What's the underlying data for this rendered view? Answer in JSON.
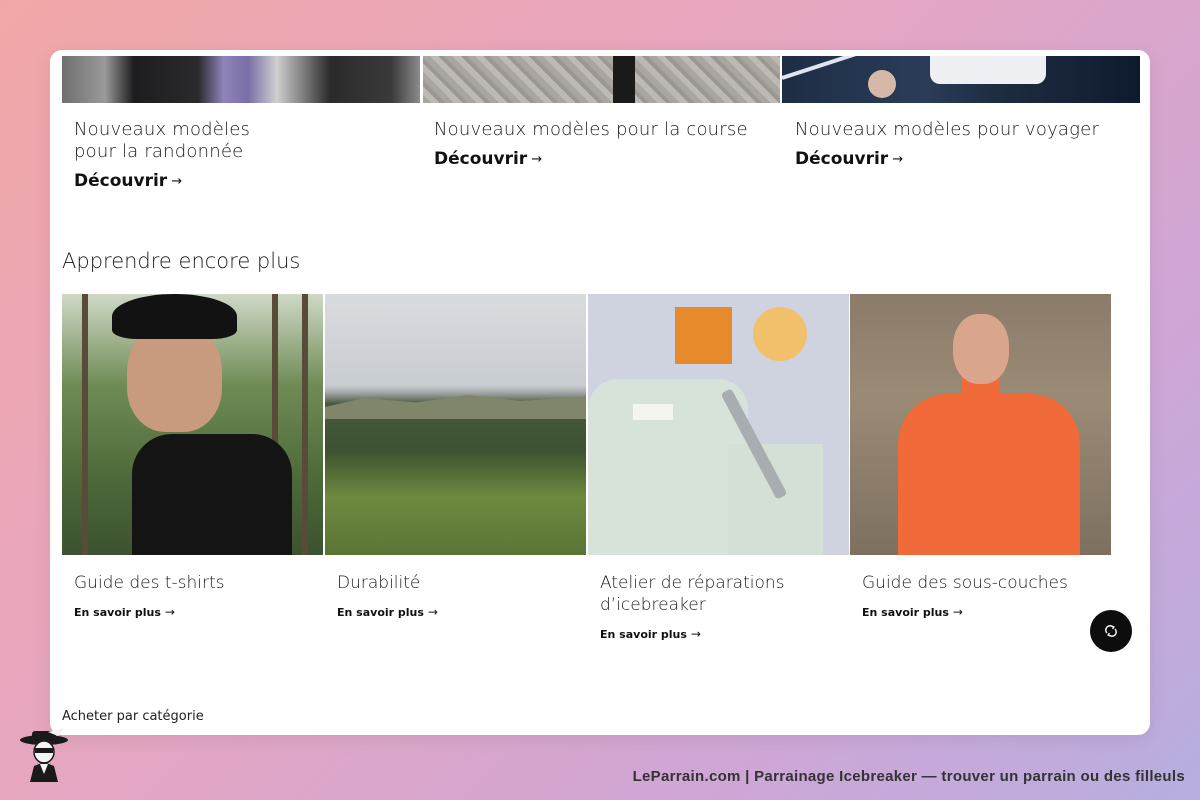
{
  "promos": [
    {
      "title": "Nouveaux modèles pour la randonnée",
      "link": "Découvrir"
    },
    {
      "title": "Nouveaux modèles pour la course",
      "link": "Découvrir"
    },
    {
      "title": "Nouveaux modèles pour voyager",
      "link": "Découvrir"
    }
  ],
  "learn": {
    "title": "Apprendre encore plus",
    "tiles": [
      {
        "title": "Guide des t-shirts",
        "link": "En savoir plus"
      },
      {
        "title": "Durabilité",
        "link": "En savoir plus"
      },
      {
        "title": "Atelier de réparations d’icebreaker",
        "link": "En savoir plus"
      },
      {
        "title": "Guide des sous-couches",
        "link": "En savoir plus"
      }
    ]
  },
  "footer": {
    "shop_by_category": "Acheter par catégorie"
  },
  "chat": {
    "icon": "chat-icon"
  },
  "watermark": {
    "text": "LeParrain.com | Parrainage Icebreaker — trouver un parrain ou des filleuls"
  },
  "icons": {
    "arrow": "→"
  }
}
